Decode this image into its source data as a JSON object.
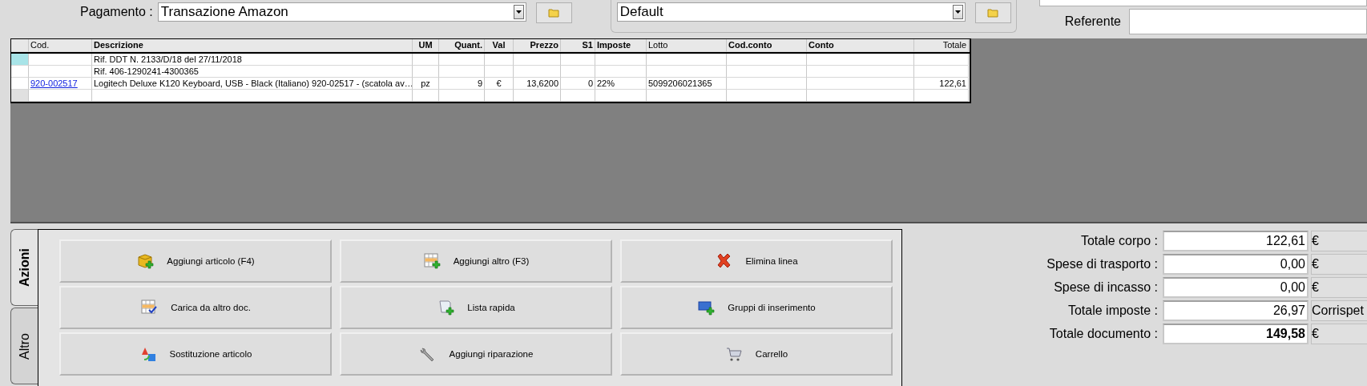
{
  "payment": {
    "label": "Pagamento :",
    "value": "Transazione Amazon"
  },
  "profile": {
    "value": "Default"
  },
  "referente": {
    "label": "Referente"
  },
  "table": {
    "columns": [
      {
        "label": "Cod.",
        "bold": false
      },
      {
        "label": "Descrizione",
        "bold": true
      },
      {
        "label": "UM",
        "bold": true
      },
      {
        "label": "Quant.",
        "bold": true
      },
      {
        "label": "Val",
        "bold": true
      },
      {
        "label": "Prezzo",
        "bold": true
      },
      {
        "label": "S1",
        "bold": true
      },
      {
        "label": "Imposte",
        "bold": true
      },
      {
        "label": "Lotto",
        "bold": false
      },
      {
        "label": "Cod.conto",
        "bold": true
      },
      {
        "label": "Conto",
        "bold": true
      },
      {
        "label": "Totale",
        "bold": false
      }
    ],
    "rows": [
      {
        "selected": true,
        "descrizione": "Rif. DDT N. 2133/D/18 del 27/11/2018"
      },
      {
        "selected": false,
        "descrizione": "Rif. 406-1290241-4300365"
      },
      {
        "selected": false,
        "cod": "920-002517",
        "descrizione": "Logitech Deluxe K120 Keyboard, USB - Black (Italiano) 920-02517 - (scatola av…",
        "um": "pz",
        "quant": "9",
        "val": "€",
        "prezzo": "13,6200",
        "s1": "0",
        "imposte": "22%",
        "lotto": "5099206021365",
        "totale": "122,61"
      },
      {
        "selected": false
      }
    ]
  },
  "tabs": [
    {
      "label": "Azioni",
      "selected": true
    },
    {
      "label": "Altro",
      "selected": false
    }
  ],
  "actions": [
    "Aggiungi articolo (F4)",
    "Aggiungi altro (F3)",
    "Elimina linea",
    "Carica da altro doc.",
    "Lista rapida",
    "Gruppi di inserimento",
    "Sostituzione articolo",
    "Aggiungi riparazione",
    "Carrello"
  ],
  "totals": [
    {
      "label": "Totale corpo :",
      "value": "122,61",
      "unit": "€",
      "bold": false
    },
    {
      "label": "Spese di trasporto :",
      "value": "0,00",
      "unit": "€",
      "bold": false
    },
    {
      "label": "Spese di incasso :",
      "value": "0,00",
      "unit": "€",
      "bold": false
    },
    {
      "label": "Totale imposte :",
      "value": "26,97",
      "unit": "Corrispet",
      "bold": false
    },
    {
      "label": "Totale documento :",
      "value": "149,58",
      "unit": "€",
      "bold": true
    }
  ]
}
